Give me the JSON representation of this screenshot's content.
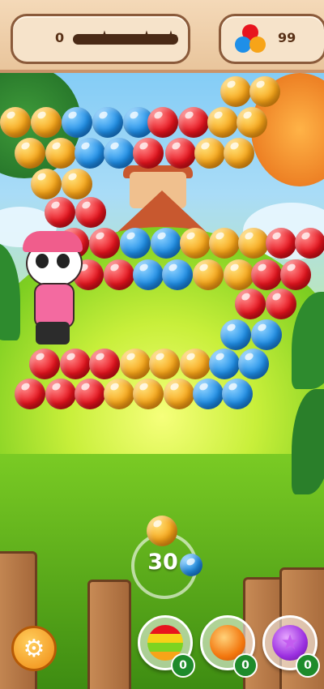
{
  "header": {
    "score": "0",
    "coin_count": "99",
    "progress_fraction": 0,
    "stars_total": 3
  },
  "shooter": {
    "shots_left": "30",
    "current_bubble": "orange",
    "next_bubble": "blue"
  },
  "boosters": [
    {
      "name": "rainbow-bubble",
      "count": "0"
    },
    {
      "name": "fire-bubble",
      "count": "0"
    },
    {
      "name": "star-bubble",
      "count": "0"
    }
  ],
  "board": {
    "rows": [
      [
        "orange",
        "orange",
        "blue",
        "blue",
        "blue",
        "red",
        "red",
        "orange",
        "orange"
      ],
      [
        "orange",
        "orange",
        "blue",
        "blue",
        "red",
        "red",
        "orange",
        "orange"
      ],
      [
        "orange",
        "orange"
      ],
      [
        "red",
        "red"
      ],
      [
        "red",
        "red",
        "blue",
        "blue",
        "orange",
        "orange",
        "orange",
        "red",
        "red"
      ],
      [
        "red",
        "red",
        "blue",
        "blue",
        "orange",
        "orange",
        "red",
        "red"
      ],
      [
        "red",
        "red"
      ],
      [
        "blue",
        "blue"
      ],
      [
        "red",
        "red",
        "red",
        "orange",
        "orange",
        "orange",
        "blue",
        "blue"
      ],
      [
        "red",
        "red",
        "red",
        "orange",
        "orange",
        "orange",
        "blue",
        "blue"
      ]
    ],
    "top_right_extra": [
      "orange",
      "orange"
    ]
  },
  "colors": {
    "orange": "#f7a418",
    "blue": "#1f8fe8",
    "red": "#e8141e",
    "wood": "#a5683a"
  },
  "icons": {
    "settings": "gear-icon",
    "coins": "tri-bubble-coin-icon",
    "progress_star": "star-icon"
  }
}
